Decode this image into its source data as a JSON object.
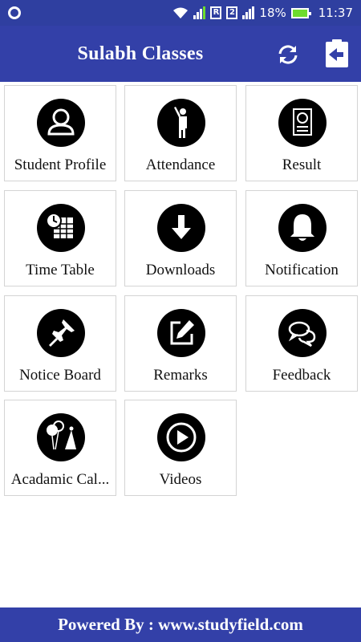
{
  "status_bar": {
    "battery": "18%",
    "time": "11:37",
    "sim1": "R",
    "sim2": "2",
    "icons": [
      "wifi-icon",
      "signal-icon",
      "battery-icon",
      "app-notification-icon"
    ]
  },
  "app_bar": {
    "title": "Sulabh Classes",
    "refresh_icon": "refresh-icon",
    "logout_icon": "logout-icon"
  },
  "tiles": [
    {
      "label": "Student Profile",
      "icon": "person-icon"
    },
    {
      "label": "Attendance",
      "icon": "raised-hand-icon"
    },
    {
      "label": "Result",
      "icon": "result-report-icon"
    },
    {
      "label": "Time Table",
      "icon": "clock-calendar-icon"
    },
    {
      "label": "Downloads",
      "icon": "download-arrow-icon"
    },
    {
      "label": "Notification",
      "icon": "bell-icon"
    },
    {
      "label": "Notice Board",
      "icon": "pushpin-icon"
    },
    {
      "label": "Remarks",
      "icon": "edit-pen-icon"
    },
    {
      "label": "Feedback",
      "icon": "chat-bubbles-icon"
    },
    {
      "label": "Acadamic Cal...",
      "icon": "party-balloons-icon"
    },
    {
      "label": "Videos",
      "icon": "play-circle-icon"
    }
  ],
  "footer": {
    "text": "Powered By : www.studyfield.com"
  },
  "colors": {
    "primary": "#3340a8",
    "status_bar": "#2f3fa0",
    "icon_fill": "#000000"
  }
}
